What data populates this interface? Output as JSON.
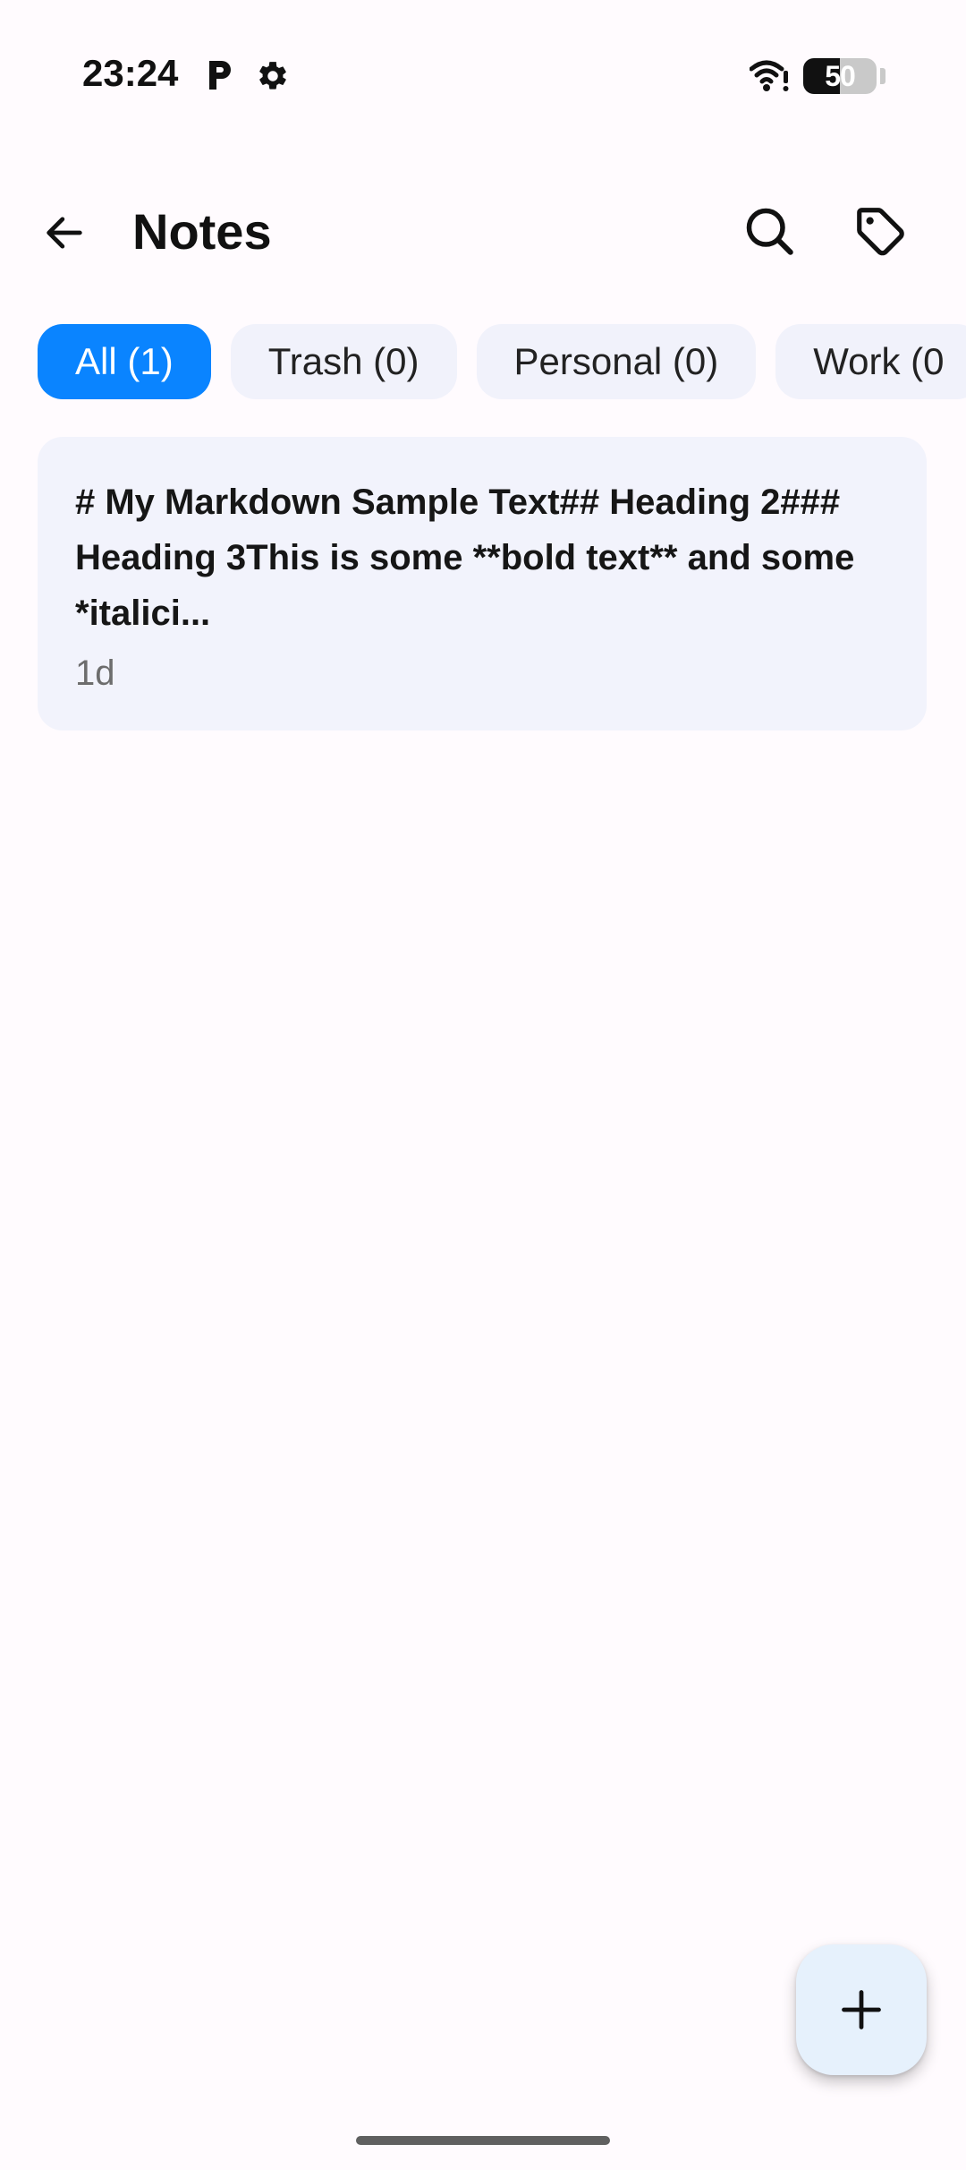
{
  "status_bar": {
    "time": "23:24",
    "battery_level": "50",
    "icons": [
      "parking-icon",
      "gear-icon",
      "wifi-icon",
      "battery-icon"
    ]
  },
  "app_bar": {
    "title": "Notes",
    "icons": [
      "back-arrow-icon",
      "search-icon",
      "tag-icon"
    ]
  },
  "filters": [
    {
      "label": "All (1)",
      "active": true
    },
    {
      "label": "Trash (0)",
      "active": false
    },
    {
      "label": "Personal (0)",
      "active": false
    },
    {
      "label": "Work (0",
      "active": false
    }
  ],
  "notes": [
    {
      "preview": "# My Markdown Sample Text## Heading 2### Heading 3This is some **bold text** and some *italici...",
      "time": "1d"
    }
  ],
  "fab": {
    "icon": "plus-icon"
  },
  "colors": {
    "accent": "#0A84FF",
    "chip_bg": "#F1F2FB",
    "card_bg": "#F2F3FC",
    "fab_bg": "#E6F1FC",
    "page_bg": "#FFFBFE"
  }
}
